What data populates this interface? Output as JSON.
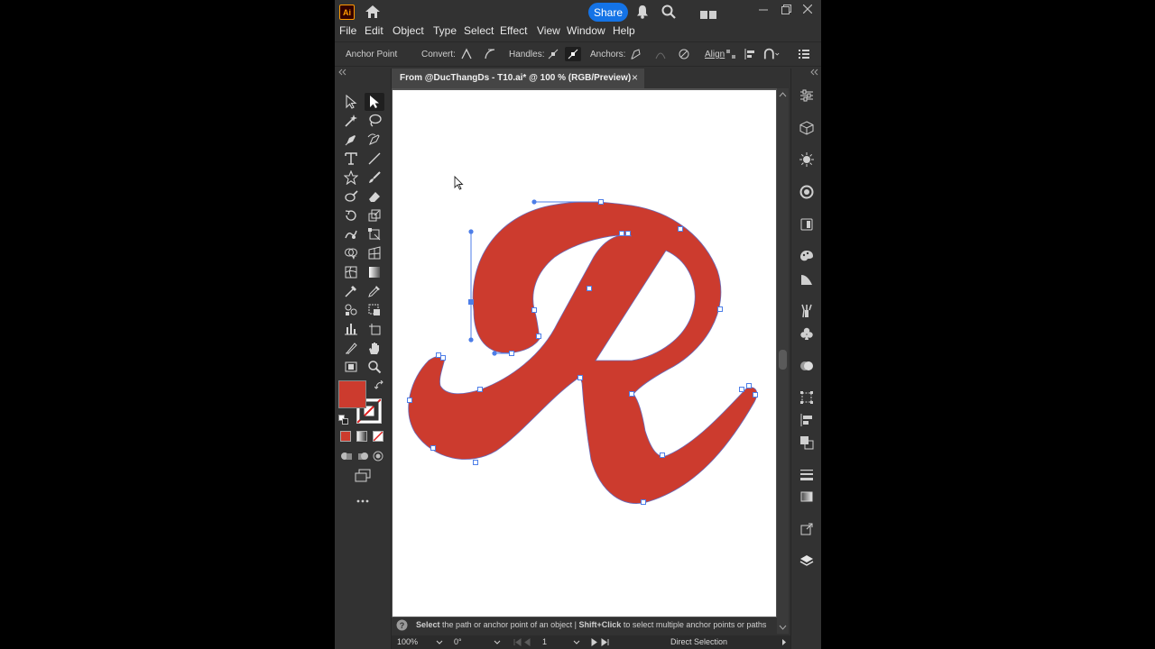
{
  "app": {
    "logo_text": "Ai",
    "share_label": "Share"
  },
  "menu": [
    "File",
    "Edit",
    "Object",
    "Type",
    "Select",
    "Effect",
    "View",
    "Window",
    "Help"
  ],
  "control_bar": {
    "anchor_point": "Anchor Point",
    "convert": "Convert:",
    "handles": "Handles:",
    "anchors": "Anchors:",
    "align": "Align"
  },
  "document": {
    "tab_title": "From @DucThangDs - T10.ai* @ 100 % (RGB/Preview)",
    "close": "×"
  },
  "hint": {
    "select_bold": "Select",
    "select_rest": "the path or anchor point of an object",
    "separator": "|",
    "shift_bold": "Shift+Click",
    "shift_rest": "to select multiple anchor points or paths"
  },
  "status": {
    "zoom": "100%",
    "rotation": "0°",
    "artboard": "1",
    "tool_name": "Direct Selection"
  },
  "colors": {
    "fill": "#cc3b2e",
    "accent": "#1473e6",
    "ui_bg": "#323232",
    "selection": "#4d7ee8"
  },
  "artwork": {
    "glyph": "R"
  }
}
